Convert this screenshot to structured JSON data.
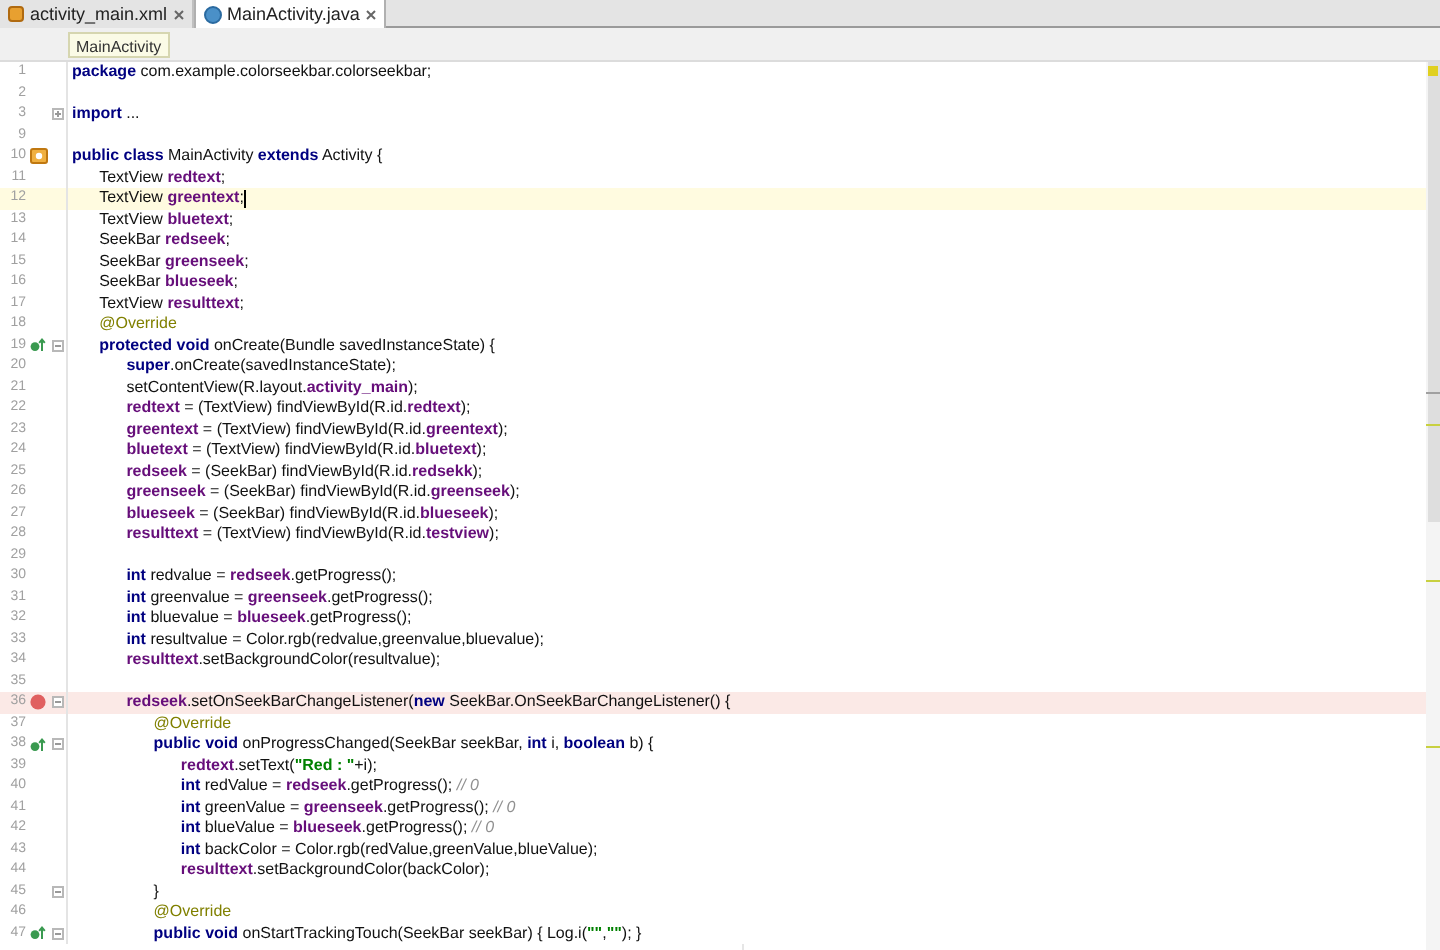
{
  "tabs": [
    {
      "label": "activity_main.xml",
      "kind": "xml",
      "selected": false
    },
    {
      "label": "MainActivity.java",
      "kind": "java",
      "selected": true
    }
  ],
  "breadcrumb": "MainActivity",
  "lines": [
    {
      "number": "1",
      "kind": "code",
      "tokens": [
        {
          "kind": "keyword",
          "text": "package"
        },
        {
          "kind": "plain",
          "text": " com.example.colorseekbar.colorseekbar;"
        }
      ]
    },
    {
      "number": "2",
      "kind": "blank"
    },
    {
      "number": "3",
      "kind": "code",
      "fold": true,
      "expanded": false,
      "tokens": [
        {
          "kind": "keyword",
          "text": "import"
        },
        {
          "kind": "plain",
          "text": " ..."
        }
      ]
    },
    {
      "number": "9",
      "kind": "blank"
    },
    {
      "number": "10",
      "kind": "class",
      "tokens": [
        {
          "kind": "keyword",
          "text": "public class"
        },
        {
          "kind": "plain",
          "text": " MainActivity "
        },
        {
          "kind": "keyword",
          "text": "extends"
        },
        {
          "kind": "plain",
          "text": " Activity {"
        }
      ],
      "children": [
        {
          "number": "11",
          "kind": "code",
          "tokens": [
            {
              "kind": "plain",
              "text": "TextView "
            },
            {
              "kind": "field",
              "text": "redtext"
            },
            {
              "kind": "plain",
              "text": ";"
            }
          ]
        },
        {
          "number": "12",
          "kind": "code",
          "current": true,
          "tokens": [
            {
              "kind": "plain",
              "text": "TextView "
            },
            {
              "kind": "field",
              "text": "greentext"
            },
            {
              "kind": "plain",
              "text": ";"
            }
          ]
        },
        {
          "number": "13",
          "kind": "code",
          "tokens": [
            {
              "kind": "plain",
              "text": "TextView "
            },
            {
              "kind": "field",
              "text": "bluetext"
            },
            {
              "kind": "plain",
              "text": ";"
            }
          ]
        },
        {
          "number": "14",
          "kind": "code",
          "tokens": [
            {
              "kind": "plain",
              "text": "SeekBar "
            },
            {
              "kind": "field",
              "text": "redseek"
            },
            {
              "kind": "plain",
              "text": ";"
            }
          ]
        },
        {
          "number": "15",
          "kind": "code",
          "tokens": [
            {
              "kind": "plain",
              "text": "SeekBar "
            },
            {
              "kind": "field",
              "text": "greenseek"
            },
            {
              "kind": "plain",
              "text": ";"
            }
          ]
        },
        {
          "number": "16",
          "kind": "code",
          "tokens": [
            {
              "kind": "plain",
              "text": "SeekBar "
            },
            {
              "kind": "field",
              "text": "blueseek"
            },
            {
              "kind": "plain",
              "text": ";"
            }
          ]
        },
        {
          "number": "17",
          "kind": "code",
          "tokens": [
            {
              "kind": "plain",
              "text": "TextView "
            },
            {
              "kind": "field",
              "text": "resulttext"
            },
            {
              "kind": "plain",
              "text": ";"
            }
          ]
        },
        {
          "number": "18",
          "kind": "code",
          "tokens": [
            {
              "kind": "annotation",
              "text": "@Override"
            }
          ]
        },
        {
          "number": "19",
          "kind": "override",
          "fold": true,
          "tokens": [
            {
              "kind": "keyword",
              "text": "protected void"
            },
            {
              "kind": "plain",
              "text": " onCreate(Bundle savedInstanceState) {"
            }
          ],
          "children": [
            {
              "number": "20",
              "kind": "code",
              "tokens": [
                {
                  "kind": "keyword",
                  "text": "super"
                },
                {
                  "kind": "plain",
                  "text": ".onCreate(savedInstanceState);"
                }
              ]
            },
            {
              "number": "21",
              "kind": "code",
              "tokens": [
                {
                  "kind": "plain",
                  "text": "setContentView(R.layout."
                },
                {
                  "kind": "field",
                  "text": "activity_main"
                },
                {
                  "kind": "plain",
                  "text": ");"
                }
              ]
            },
            {
              "number": "22",
              "kind": "code",
              "tokens": [
                {
                  "kind": "field",
                  "text": "redtext"
                },
                {
                  "kind": "plain",
                  "text": " = (TextView) findViewById(R.id."
                },
                {
                  "kind": "field",
                  "text": "redtext"
                },
                {
                  "kind": "plain",
                  "text": ");"
                }
              ]
            },
            {
              "number": "23",
              "kind": "code",
              "tokens": [
                {
                  "kind": "field",
                  "text": "greentext"
                },
                {
                  "kind": "plain",
                  "text": " = (TextView) findViewById(R.id."
                },
                {
                  "kind": "field",
                  "text": "greentext"
                },
                {
                  "kind": "plain",
                  "text": ");"
                }
              ]
            },
            {
              "number": "24",
              "kind": "code",
              "tokens": [
                {
                  "kind": "field",
                  "text": "bluetext"
                },
                {
                  "kind": "plain",
                  "text": " = (TextView) findViewById(R.id."
                },
                {
                  "kind": "field",
                  "text": "bluetext"
                },
                {
                  "kind": "plain",
                  "text": ");"
                }
              ]
            },
            {
              "number": "25",
              "kind": "code",
              "tokens": [
                {
                  "kind": "field",
                  "text": "redseek"
                },
                {
                  "kind": "plain",
                  "text": " = (SeekBar) findViewById(R.id."
                },
                {
                  "kind": "field",
                  "text": "redsekk"
                },
                {
                  "kind": "plain",
                  "text": ");"
                }
              ]
            },
            {
              "number": "26",
              "kind": "code",
              "tokens": [
                {
                  "kind": "field",
                  "text": "greenseek"
                },
                {
                  "kind": "plain",
                  "text": " = (SeekBar) findViewById(R.id."
                },
                {
                  "kind": "field",
                  "text": "greenseek"
                },
                {
                  "kind": "plain",
                  "text": ");"
                }
              ]
            },
            {
              "number": "27",
              "kind": "code",
              "tokens": [
                {
                  "kind": "field",
                  "text": "blueseek"
                },
                {
                  "kind": "plain",
                  "text": " = (SeekBar) findViewById(R.id."
                },
                {
                  "kind": "field",
                  "text": "blueseek"
                },
                {
                  "kind": "plain",
                  "text": ");"
                }
              ]
            },
            {
              "number": "28",
              "kind": "code",
              "tokens": [
                {
                  "kind": "field",
                  "text": "resulttext"
                },
                {
                  "kind": "plain",
                  "text": " = (TextView) findViewById(R.id."
                },
                {
                  "kind": "field",
                  "text": "testview"
                },
                {
                  "kind": "plain",
                  "text": ");"
                }
              ]
            },
            {
              "number": "29",
              "kind": "blank"
            },
            {
              "number": "30",
              "kind": "code",
              "tokens": [
                {
                  "kind": "keyword",
                  "text": "int"
                },
                {
                  "kind": "plain",
                  "text": " redvalue = "
                },
                {
                  "kind": "field",
                  "text": "redseek"
                },
                {
                  "kind": "plain",
                  "text": ".getProgress();"
                }
              ]
            },
            {
              "number": "31",
              "kind": "code",
              "tokens": [
                {
                  "kind": "keyword",
                  "text": "int"
                },
                {
                  "kind": "plain",
                  "text": " greenvalue = "
                },
                {
                  "kind": "field",
                  "text": "greenseek"
                },
                {
                  "kind": "plain",
                  "text": ".getProgress();"
                }
              ]
            },
            {
              "number": "32",
              "kind": "code",
              "tokens": [
                {
                  "kind": "keyword",
                  "text": "int"
                },
                {
                  "kind": "plain",
                  "text": " bluevalue = "
                },
                {
                  "kind": "field",
                  "text": "blueseek"
                },
                {
                  "kind": "plain",
                  "text": ".getProgress();"
                }
              ]
            },
            {
              "number": "33",
              "kind": "code",
              "tokens": [
                {
                  "kind": "keyword",
                  "text": "int"
                },
                {
                  "kind": "plain",
                  "text": " resultvalue = Color.rgb(redvalue,greenvalue,bluevalue);"
                }
              ]
            },
            {
              "number": "34",
              "kind": "code",
              "tokens": [
                {
                  "kind": "field",
                  "text": "resulttext"
                },
                {
                  "kind": "plain",
                  "text": ".setBackgroundColor(resultvalue);"
                }
              ]
            },
            {
              "number": "35",
              "kind": "blank"
            },
            {
              "number": "36",
              "kind": "breakpoint",
              "fold": true,
              "tokens": [
                {
                  "kind": "field",
                  "text": "redseek"
                },
                {
                  "kind": "plain",
                  "text": ".setOnSeekBarChangeListener("
                },
                {
                  "kind": "keyword",
                  "text": "new"
                },
                {
                  "kind": "plain",
                  "text": " SeekBar.OnSeekBarChangeListener() {"
                }
              ],
              "children": [
                {
                  "number": "37",
                  "kind": "code",
                  "tokens": [
                    {
                      "kind": "annotation",
                      "text": "@Override"
                    }
                  ]
                },
                {
                  "number": "38",
                  "kind": "override",
                  "fold": true,
                  "tokens": [
                    {
                      "kind": "keyword",
                      "text": "public void"
                    },
                    {
                      "kind": "plain",
                      "text": " onProgressChanged(SeekBar seekBar, "
                    },
                    {
                      "kind": "keyword",
                      "text": "int"
                    },
                    {
                      "kind": "plain",
                      "text": " i, "
                    },
                    {
                      "kind": "keyword",
                      "text": "boolean"
                    },
                    {
                      "kind": "plain",
                      "text": " b) {"
                    }
                  ],
                  "children": [
                    {
                      "number": "39",
                      "kind": "code",
                      "tokens": [
                        {
                          "kind": "field",
                          "text": "redtext"
                        },
                        {
                          "kind": "plain",
                          "text": ".setText("
                        },
                        {
                          "kind": "string",
                          "text": "\"Red : \""
                        },
                        {
                          "kind": "plain",
                          "text": "+i);"
                        }
                      ]
                    },
                    {
                      "number": "40",
                      "kind": "code",
                      "tokens": [
                        {
                          "kind": "keyword",
                          "text": "int"
                        },
                        {
                          "kind": "plain",
                          "text": " redValue = "
                        },
                        {
                          "kind": "field",
                          "text": "redseek"
                        },
                        {
                          "kind": "plain",
                          "text": ".getProgress(); "
                        },
                        {
                          "kind": "comment",
                          "text": "// 0"
                        }
                      ]
                    },
                    {
                      "number": "41",
                      "kind": "code",
                      "tokens": [
                        {
                          "kind": "keyword",
                          "text": "int"
                        },
                        {
                          "kind": "plain",
                          "text": " greenValue = "
                        },
                        {
                          "kind": "field",
                          "text": "greenseek"
                        },
                        {
                          "kind": "plain",
                          "text": ".getProgress(); "
                        },
                        {
                          "kind": "comment",
                          "text": "// 0"
                        }
                      ]
                    },
                    {
                      "number": "42",
                      "kind": "code",
                      "tokens": [
                        {
                          "kind": "keyword",
                          "text": "int"
                        },
                        {
                          "kind": "plain",
                          "text": " blueValue = "
                        },
                        {
                          "kind": "field",
                          "text": "blueseek"
                        },
                        {
                          "kind": "plain",
                          "text": ".getProgress(); "
                        },
                        {
                          "kind": "comment",
                          "text": "// 0"
                        }
                      ]
                    },
                    {
                      "number": "43",
                      "kind": "code",
                      "tokens": [
                        {
                          "kind": "keyword",
                          "text": "int"
                        },
                        {
                          "kind": "plain",
                          "text": " backColor = Color.rgb(redValue,greenValue,blueValue);"
                        }
                      ]
                    },
                    {
                      "number": "44",
                      "kind": "code",
                      "tokens": [
                        {
                          "kind": "field",
                          "text": "resulttext"
                        },
                        {
                          "kind": "plain",
                          "text": ".setBackgroundColor(backColor);"
                        }
                      ]
                    }
                  ]
                },
                {
                  "number": "45",
                  "kind": "code",
                  "fold": true,
                  "tokens": [
                    {
                      "kind": "plain",
                      "text": "}"
                    }
                  ]
                },
                {
                  "number": "46",
                  "kind": "code",
                  "tokens": [
                    {
                      "kind": "annotation",
                      "text": "@Override"
                    }
                  ]
                },
                {
                  "number": "47",
                  "kind": "override",
                  "fold": true,
                  "tokens": [
                    {
                      "kind": "keyword",
                      "text": "public void"
                    },
                    {
                      "kind": "plain",
                      "text": " onStartTrackingTouch(SeekBar seekBar) { Log.i("
                    },
                    {
                      "kind": "string",
                      "text": "\"\""
                    },
                    {
                      "kind": "plain",
                      "text": ","
                    },
                    {
                      "kind": "string",
                      "text": "\"\""
                    },
                    {
                      "kind": "plain",
                      "text": "); }"
                    }
                  ]
                }
              ]
            }
          ]
        }
      ]
    }
  ]
}
